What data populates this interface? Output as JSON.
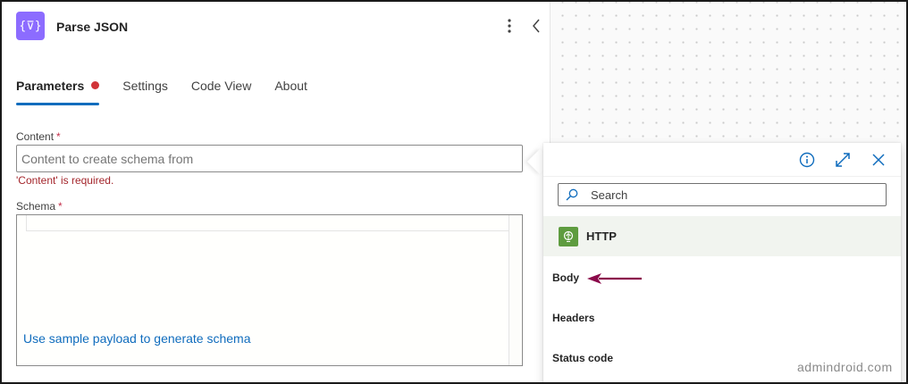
{
  "header": {
    "icon_glyph": "{⊽}",
    "title": "Parse JSON"
  },
  "tabs": [
    {
      "label": "Parameters",
      "active": true,
      "has_error": true
    },
    {
      "label": "Settings",
      "active": false
    },
    {
      "label": "Code View",
      "active": false
    },
    {
      "label": "About",
      "active": false
    }
  ],
  "content_field": {
    "label": "Content",
    "required_mark": "*",
    "placeholder": "Content to create schema from",
    "error": "'Content' is required."
  },
  "schema_field": {
    "label": "Schema",
    "required_mark": "*",
    "link": "Use sample payload to generate schema"
  },
  "picker": {
    "search_placeholder": "Search",
    "group": {
      "name": "HTTP",
      "icon": "globe-icon"
    },
    "items": [
      "Body",
      "Headers",
      "Status code"
    ]
  },
  "watermark": "admindroid.com",
  "colors": {
    "accent": "#0f6cbd",
    "action_icon": "#8c6cff",
    "error": "#a4262c",
    "http_icon": "#5e9c3f",
    "arrow": "#8b0a4b"
  }
}
